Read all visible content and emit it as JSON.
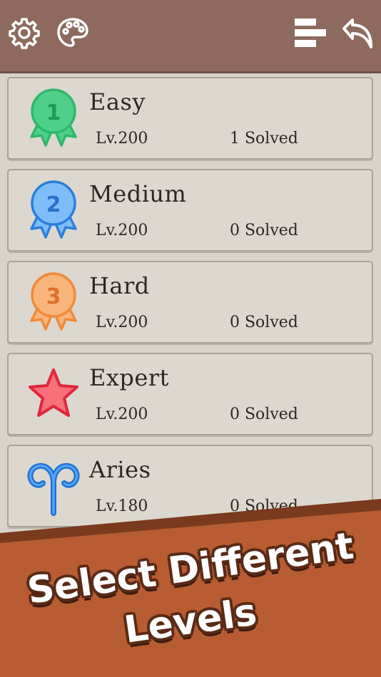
{
  "topbar": {
    "icons": [
      "gear-icon",
      "palette-icon",
      "ranking-icon",
      "undo-icon"
    ]
  },
  "levels": [
    {
      "title": "Easy",
      "level": "Lv.200",
      "solved": "1 Solved",
      "badge": "1",
      "badge_type": "ribbon",
      "color": "#2fb86a"
    },
    {
      "title": "Medium",
      "level": "Lv.200",
      "solved": "0 Solved",
      "badge": "2",
      "badge_type": "ribbon",
      "color": "#3a8fe0"
    },
    {
      "title": "Hard",
      "level": "Lv.200",
      "solved": "0 Solved",
      "badge": "3",
      "badge_type": "ribbon",
      "color": "#f08a3a"
    },
    {
      "title": "Expert",
      "level": "Lv.200",
      "solved": "0 Solved",
      "badge": "",
      "badge_type": "star",
      "color": "#e8323e"
    },
    {
      "title": "Aries",
      "level": "Lv.180",
      "solved": "0 Solved",
      "badge": "",
      "badge_type": "aries",
      "color": "#1e73d6"
    }
  ],
  "promo": {
    "line1": "Select Different",
    "line2": "Levels"
  },
  "colors": {
    "topbar": "#8d6a5d",
    "banner": "#b85d33",
    "banner_dark": "#7a3a1e"
  }
}
